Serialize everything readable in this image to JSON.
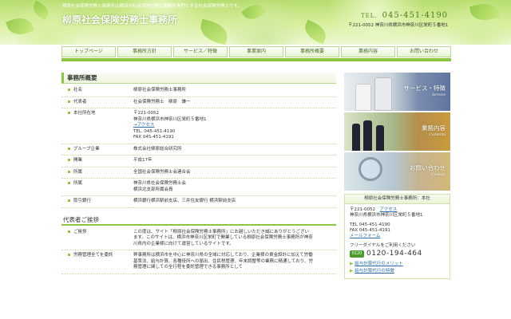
{
  "header": {
    "tagline": "柳原社会保険労務士事務所は横浜の社会保険労務士報酬を専門とする社会保険労務士です。",
    "site_title": "柳原社会保険労務士事務所",
    "tel_label": "TEL.",
    "tel_number": "045-451-4190",
    "address": "〒221-0052 神奈川県横浜市神奈川区栄町５番地1"
  },
  "nav": {
    "items": [
      "トップページ",
      "事務所方針",
      "サービス／特徴",
      "事業案内",
      "事務所概要",
      "業務内容",
      "お問い合わせ"
    ]
  },
  "main": {
    "section_title": "事務所概要",
    "rows": [
      {
        "label": "社名",
        "lines": [
          "柳原社会保険労務士事務所"
        ]
      },
      {
        "label": "代表者",
        "lines": [
          "社会保険労務士　柳原　謙一"
        ]
      },
      {
        "label": "本社所在地",
        "lines": [
          "〒221-0052",
          "神奈川県横浜市神奈川区栄町５番地1"
        ],
        "link": "→アクセス",
        "lines_after": [
          "TEL. 045-451-4190",
          "FAX 045-451-4191"
        ]
      },
      {
        "label": "グループ企業",
        "lines": [
          "株式会社柳原総合研究所"
        ]
      },
      {
        "label": "開業",
        "lines": [
          "平成17年"
        ]
      },
      {
        "label": "所属",
        "lines": [
          "全国社会保険労務士会連合会"
        ]
      },
      {
        "label": "所属",
        "lines": [
          "神奈川県社会保険労務士会",
          "横浜北支部所属会員"
        ]
      },
      {
        "label": "取引銀行",
        "lines": [
          "横浜銀行横浜駅前支店、三井住友銀行 横浜駅前支店"
        ]
      }
    ],
    "greeting_title": "代表者ご挨拶",
    "greeting_rows": [
      {
        "label": "ご挨拶",
        "lines": [
          "この度は、サイト「柳原社会保険労務士事務所」にお越しいただき誠にありがとうござい",
          "ます。このサイトは、横浜市神奈川区栄町で開業している柳原社会保険労務士事務所が神奈",
          "川県内の企業様に向けて運営しているサイトです。"
        ]
      },
      {
        "label": "労務管理全てを委託",
        "lines": [
          "弊事務所は横浜市を中心に神奈川県の全域に対応しており、企業様の賃金設計に加えて労働",
          "基準法、給与計算、各種役所への届出、住民税管理、年末調整等の業務に精通しており、労",
          "務管理に関しての全行程を委託管理できる事務所として"
        ]
      }
    ]
  },
  "sidebar": {
    "banners": [
      {
        "title": "サービス・特徴",
        "sub": "Service"
      },
      {
        "title": "業務内容",
        "sub": "Contents"
      },
      {
        "title": "お問い合わせ",
        "sub": "Contact"
      }
    ],
    "card_title": "柳原社会保険労務士事務所：本社",
    "postal": "〒221-0052",
    "access_link": "アクセス",
    "address": "神奈川県横浜市神奈川区栄町５番地1",
    "tel": "TEL 045-451-4190",
    "fax": "FAX 045-451-4191",
    "mail_link": "メールフォーム",
    "freedial_label": "フリーダイヤルをご利用ください",
    "freedial_icon": "0120",
    "freedial_number": "0120-194-464",
    "links": [
      "給与計算代行のメリット",
      "給与計算代行の特徴"
    ]
  },
  "colors": {
    "accent": "#8cc63f",
    "nav_text": "#446b1e",
    "tel": "#4b7e1c"
  }
}
